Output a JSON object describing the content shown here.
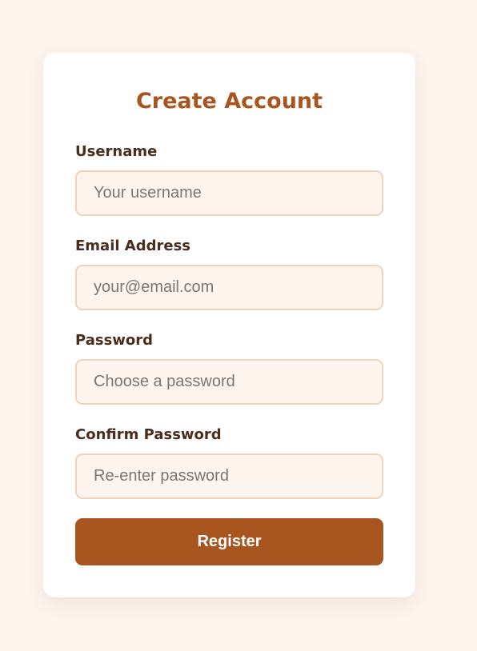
{
  "form": {
    "title": "Create Account",
    "fields": [
      {
        "label": "Username",
        "placeholder": "Your username",
        "value": ""
      },
      {
        "label": "Email Address",
        "placeholder": "your@email.com",
        "value": ""
      },
      {
        "label": "Password",
        "placeholder": "Choose a password",
        "value": ""
      },
      {
        "label": "Confirm Password",
        "placeholder": "Re-enter password",
        "value": ""
      }
    ],
    "submit_label": "Register"
  },
  "colors": {
    "background": "#fdf4ee",
    "accent": "#a85520",
    "label_text": "#4a2d1c",
    "input_border": "#eed4bd"
  }
}
